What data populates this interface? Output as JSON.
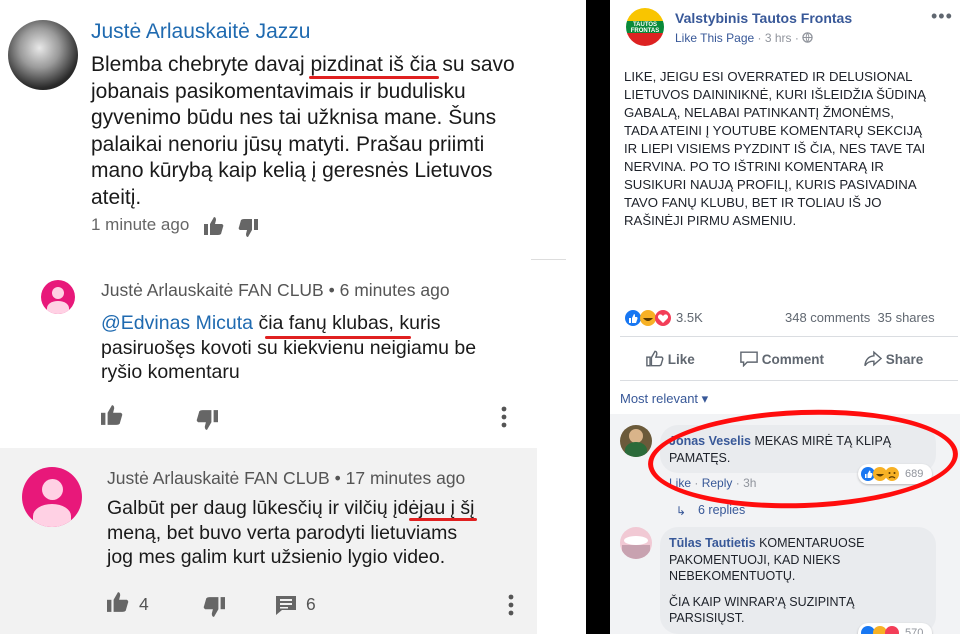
{
  "left": {
    "comment1": {
      "author": "Justė Arlauskaitė Jazzu",
      "text_lines": [
        "Blemba chebryte davaj pizdinat iš čia su savo",
        "jobanais pasikomentavimais ir budulisku",
        "gyvenimo būdu nes tai užknisa mane. Šuns",
        "palaikai nenoriu jūsų matyti. Prašau priimti",
        "mano kūrybą kaip kelią į geresnės Lietuvos",
        "ateitį."
      ],
      "time": "1 minute ago"
    },
    "comment2": {
      "author": "Justė Arlauskaitė FAN CLUB",
      "time": "6 minutes ago",
      "sep": "•",
      "mention": "@Edvinas Micuta",
      "text_first_rest": "čia fanų klubas, kuris",
      "text_lines": [
        "pasiruošęs kovoti su kiekvienu neigiamu be",
        "ryšio komentaru"
      ]
    },
    "comment3": {
      "author": "Justė Arlauskaitė FAN CLUB",
      "time": "17 minutes ago",
      "sep": "•",
      "text_lines": [
        "Galbūt per daug lūkesčių ir vilčių įdėjau į šį",
        "meną, bet buvo verta parodyti lietuviams",
        "jog mes galim kurt užsienio lygio video."
      ],
      "likes": "4",
      "replies": "6"
    }
  },
  "right": {
    "page_name": "Valstybinis Tautos Frontas",
    "logo_text": "TAUTOS FRONTAS",
    "like_this_page": "Like This Page",
    "meta_time": "· 3 hrs ·",
    "more": "•••",
    "post_lines": [
      "LIKE, JEIGU ESI OVERRATED IR DELUSIONAL",
      "LIETUVOS DAININIKNĖ, KURI IŠLEIDŽIA ŠŪDINĄ",
      "GABALĄ, NELABAI PATINKANTĮ ŽMONĖMS,",
      "TADA ATEINI Į YOUTUBE KOMENTARŲ SEKCIJĄ",
      "IR LIEPI VISIEMS PYZDINT IŠ ČIA, NES TAVE TAI",
      "NERVINA. PO TO IŠTRINI KOMENTARĄ IR",
      "SUSIKURI NAUJĄ PROFILĮ, KURIS PASIVADINA",
      "TAVO FANŲ KLUBU, BET IR TOLIAU IŠ JO",
      "RAŠINĖJI PIRMU ASMENIU."
    ],
    "reactions_count": "3.5K",
    "comments_count": "348 comments",
    "shares_count": "35 shares",
    "actions": {
      "like": "Like",
      "comment": "Comment",
      "share": "Share"
    },
    "most_relevant": "Most relevant ▾",
    "comment1": {
      "name": "Jonas Veselis",
      "text_first": "MEKAS MIRĖ TĄ KLIPĄ",
      "text_second": "PAMATĘS.",
      "like": "Like",
      "reply": "Reply",
      "time": "3h",
      "reactions": "689",
      "replies": "6 replies"
    },
    "comment2": {
      "name": "Tūlas Tautietis",
      "text_first": "KOMENTARUOSE",
      "text_lines": [
        "PAKOMENTUOJI, KAD NIEKS",
        "NEBEKOMENTUOTŲ."
      ],
      "text_para2": [
        "ČIA KAIP WINRAR'Ą SUZIPINTĄ",
        "PARSISIŲST."
      ],
      "reactions": "570"
    }
  }
}
